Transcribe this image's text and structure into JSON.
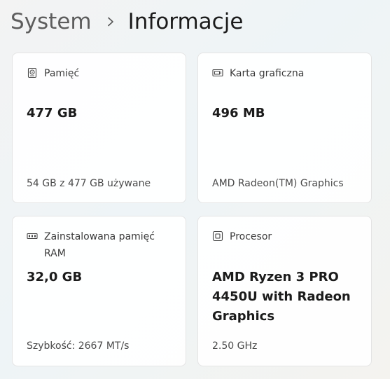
{
  "breadcrumb": {
    "parent": "System",
    "current": "Informacje"
  },
  "cards": {
    "storage": {
      "icon": "storage-drive-icon",
      "label": "Pamięć",
      "value": "477 GB",
      "detail": "54 GB z 477 GB używane"
    },
    "gpu": {
      "icon": "display-adapter-icon",
      "label": "Karta graficzna",
      "value": "496 MB",
      "detail": "AMD Radeon(TM) Graphics"
    },
    "ram": {
      "icon": "memory-module-icon",
      "label_line1": "Zainstalowana pamięć",
      "label_line2": "RAM",
      "value": "32,0 GB",
      "detail": "Szybkość: 2667 MT/s"
    },
    "cpu": {
      "icon": "processor-chip-icon",
      "label": "Procesor",
      "value_line1": "AMD Ryzen 3 PRO",
      "value_line2": "4450U with Radeon",
      "value_line3": "Graphics",
      "detail": "2.50 GHz"
    }
  }
}
